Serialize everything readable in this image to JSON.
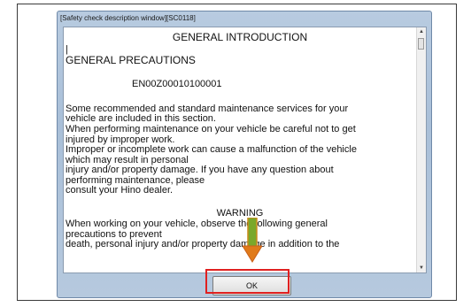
{
  "window": {
    "title": "[Safety check description window][SC0118]"
  },
  "content": {
    "heading": "GENERAL INTRODUCTION",
    "cursor": "|",
    "section_title": "GENERAL PRECAUTIONS",
    "doc_code": "EN00Z00010100001",
    "paragraph_lines": [
      "Some recommended and standard maintenance services for your",
      "vehicle are included in this section.",
      "When performing maintenance on your vehicle be careful not to get",
      "injured by improper work.",
      "Improper or incomplete work can cause a malfunction of the vehicle",
      "which may result in personal",
      "injury and/or property damage. If you have any question about",
      "performing maintenance, please",
      "consult your Hino dealer."
    ],
    "warning_heading": "WARNING",
    "warning_lines": [
      "When working on your vehicle, observe the following general",
      "precautions to prevent",
      "death, personal injury and/or property damage in addition to the"
    ]
  },
  "buttons": {
    "ok_label": "OK"
  },
  "colors": {
    "highlight": "#e02020",
    "arrow": "#7aa82a"
  }
}
